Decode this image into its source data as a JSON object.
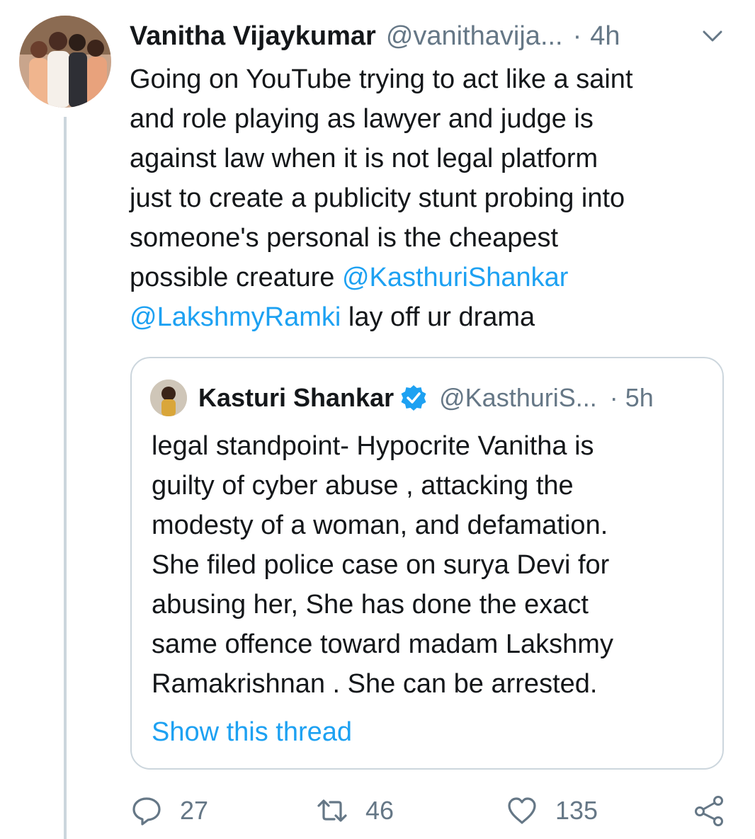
{
  "tweet": {
    "author_name": "Vanitha Vijaykumar",
    "author_handle": "@vanithavija...",
    "separator": "·",
    "time": "4h",
    "text_lines": [
      {
        "text": "Going on YouTube trying to act like a saint"
      },
      {
        "text": "and role playing as lawyer and judge is"
      },
      {
        "text": "against law when it is not legal platform"
      },
      {
        "text": "just to create a publicity stunt probing into"
      },
      {
        "text": "someone's personal is the cheapest"
      }
    ],
    "line6_prefix": "possible creature ",
    "mention_1": "@KasthuriShankar",
    "mention_2": "@LakshmyRamki",
    "line7_suffix": " lay off ur drama"
  },
  "quoted_tweet": {
    "author_name": "Kasturi Shankar",
    "author_handle": "@KasthuriS...",
    "separator": "·",
    "time": "5h",
    "text_lines": [
      "legal standpoint-  Hypocrite Vanitha is",
      "guilty of  cyber abuse , attacking the",
      "modesty of a woman, and defamation.",
      "She filed police case on surya Devi for",
      "abusing her, She has done the exact",
      "same offence toward  madam Lakshmy",
      "Ramakrishnan  . She can be arrested."
    ],
    "show_thread": "Show this thread"
  },
  "actions": {
    "reply_count": "27",
    "retweet_count": "46",
    "like_count": "135"
  },
  "icons": {
    "caret": "chevron-down-icon",
    "verified": "verified-badge-icon",
    "reply": "reply-icon",
    "retweet": "retweet-icon",
    "like": "heart-icon",
    "share": "share-icon"
  },
  "colors": {
    "link": "#1da1f2",
    "secondary_text": "#657786",
    "border": "#ccd6dd",
    "primary_text": "#14171a"
  }
}
